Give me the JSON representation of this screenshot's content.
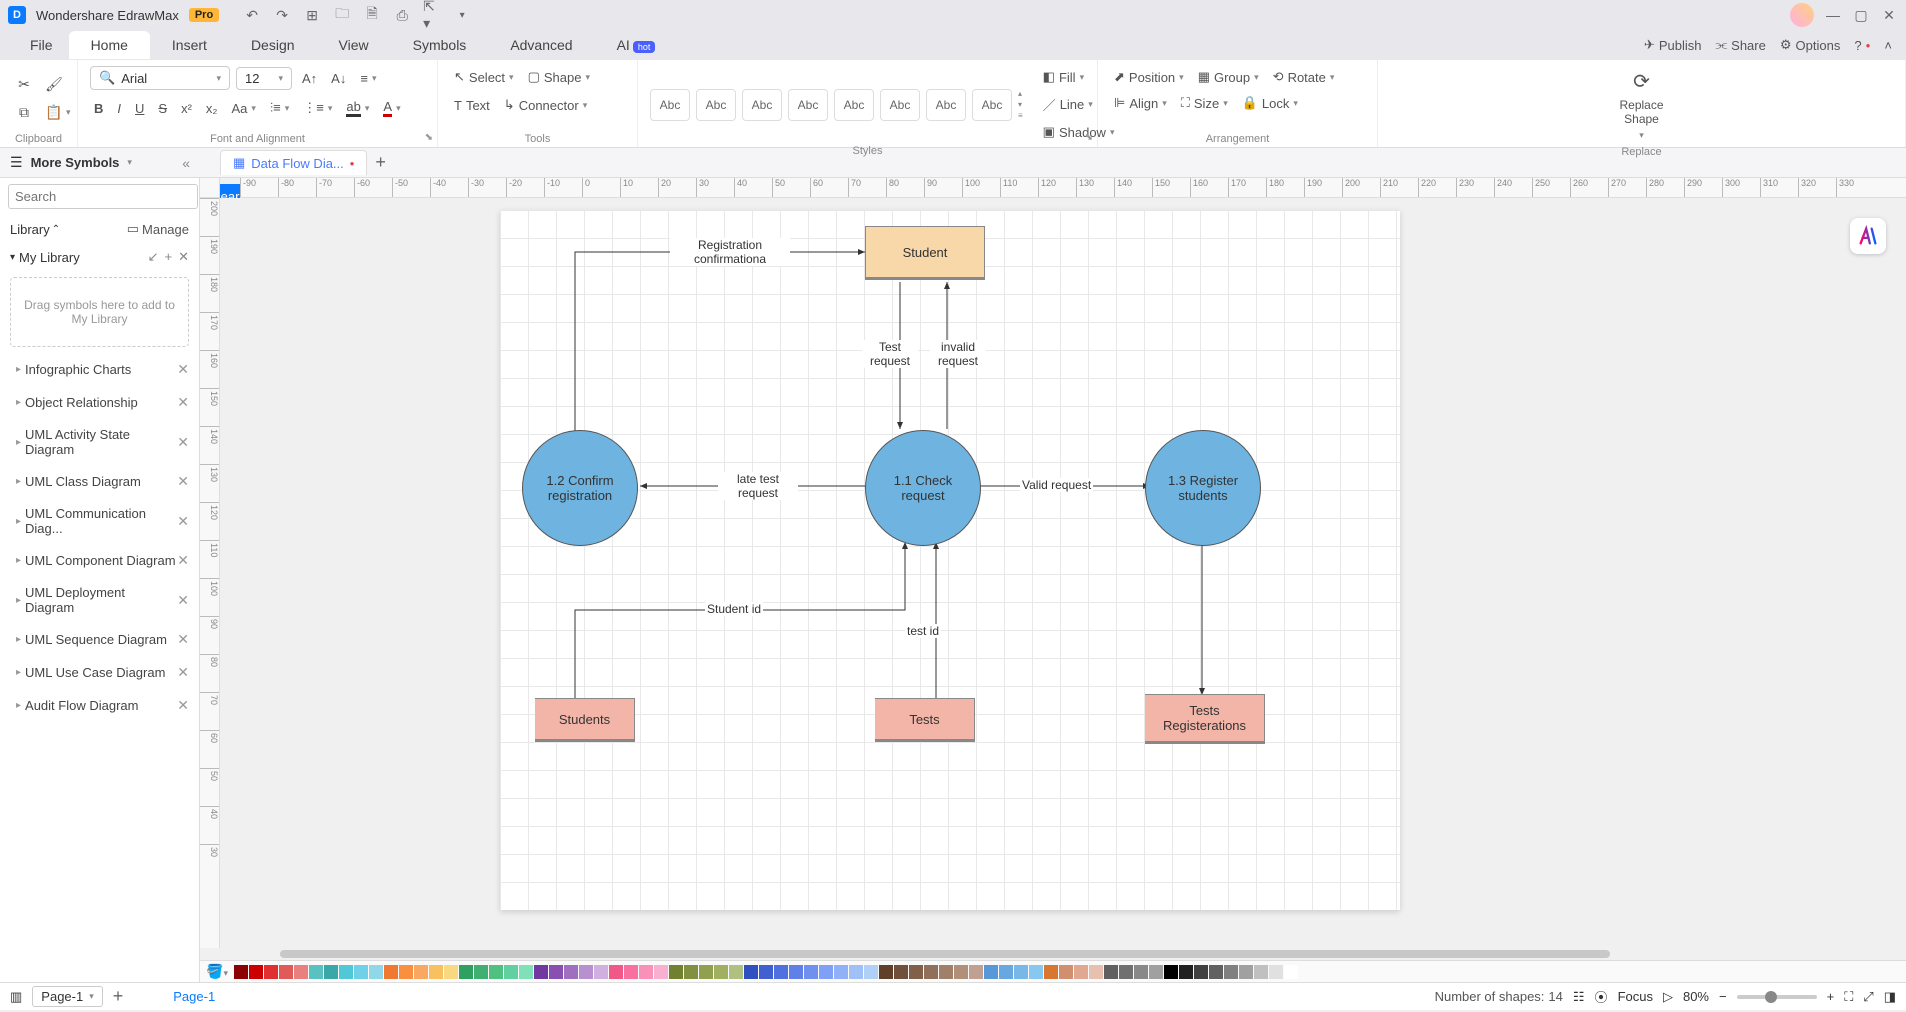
{
  "titlebar": {
    "appname": "Wondershare EdrawMax",
    "pro_badge": "Pro"
  },
  "menu": {
    "file": "File",
    "home": "Home",
    "insert": "Insert",
    "design": "Design",
    "view": "View",
    "symbols": "Symbols",
    "advanced": "Advanced",
    "ai": "AI",
    "hot": "hot",
    "publish": "Publish",
    "share": "Share",
    "options": "Options"
  },
  "ribbon": {
    "clipboard": "Clipboard",
    "font_align": "Font and Alignment",
    "tools": "Tools",
    "styles": "Styles",
    "arrangement": "Arrangement",
    "replace": "Replace",
    "font_name": "Arial",
    "font_size": "12",
    "select": "Select",
    "shape": "Shape",
    "text": "Text",
    "connector": "Connector",
    "abc": "Abc",
    "fill": "Fill",
    "line": "Line",
    "shadow": "Shadow",
    "position": "Position",
    "align": "Align",
    "group": "Group",
    "size": "Size",
    "rotate": "Rotate",
    "lock": "Lock",
    "replace_shape": "Replace\nShape"
  },
  "doc": {
    "tab_name": "Data Flow Dia...",
    "more_symbols": "More Symbols"
  },
  "sidebar": {
    "search_placeholder": "Search",
    "search_btn": "Search",
    "library": "Library",
    "manage": "Manage",
    "mylib": "My Library",
    "dropzone": "Drag symbols here to add to My Library",
    "items": [
      "Infographic Charts",
      "Object Relationship",
      "UML Activity State Diagram",
      "UML Class Diagram",
      "UML Communication Diag...",
      "UML Component Diagram",
      "UML Deployment Diagram",
      "UML Sequence Diagram",
      "UML Use Case Diagram",
      "Audit Flow Diagram"
    ]
  },
  "ruler_h": [
    "-90",
    "-80",
    "-70",
    "-60",
    "-50",
    "-40",
    "-30",
    "-20",
    "-10",
    "0",
    "10",
    "20",
    "30",
    "40",
    "50",
    "60",
    "70",
    "80",
    "90",
    "100",
    "110",
    "120",
    "130",
    "140",
    "150",
    "160",
    "170",
    "180",
    "190",
    "200",
    "210",
    "220",
    "230",
    "240",
    "250",
    "260",
    "270",
    "280",
    "290",
    "300",
    "310",
    "320",
    "330"
  ],
  "ruler_v": [
    "200",
    "190",
    "180",
    "170",
    "160",
    "150",
    "140",
    "130",
    "120",
    "110",
    "100",
    "90",
    "80",
    "70",
    "60",
    "50",
    "40",
    "30"
  ],
  "diagram": {
    "student": "Student",
    "p11": "1.1 Check request",
    "p12": "1.2 Confirm registration",
    "p13": "1.3 Register students",
    "ds_students": "Students",
    "ds_tests": "Tests",
    "ds_testsreg": "Tests Registerations",
    "lbl_regconf": "Registration confirmationa",
    "lbl_testreq": "Test request",
    "lbl_invalid": "invalid request",
    "lbl_latetest": "late test request",
    "lbl_valid": "Valid request",
    "lbl_studentid": "Student id",
    "lbl_testid": "test id"
  },
  "palette": [
    "#8b0000",
    "#c00",
    "#e03030",
    "#e05a5a",
    "#e88080",
    "#5ac0c0",
    "#3aa8a8",
    "#50c8d8",
    "#70d0e8",
    "#90d8e8",
    "#f07830",
    "#f89040",
    "#f8a860",
    "#f8c060",
    "#f8d880",
    "#30a060",
    "#40b070",
    "#50c080",
    "#60d0a0",
    "#80e0b8",
    "#7038a0",
    "#8850b0",
    "#a070c0",
    "#b890d0",
    "#d0b0e0",
    "#f05888",
    "#f870a0",
    "#f890b8",
    "#f8b0d0",
    "#708030",
    "#809040",
    "#90a050",
    "#a0b060",
    "#b0c080",
    "#3050c0",
    "#4060d0",
    "#5070e0",
    "#6080e8",
    "#7090f0",
    "#80a0f8",
    "#90b0f8",
    "#a0c0f8",
    "#b0d0f8",
    "#604028",
    "#705038",
    "#806048",
    "#907058",
    "#a08068",
    "#b09078",
    "#c0a090",
    "#5898d8",
    "#68a8e0",
    "#78b8e8",
    "#88c8f0",
    "#d87830",
    "#d09070",
    "#e0a890",
    "#e8c0b0",
    "#606060",
    "#707070",
    "#888",
    "#a0a0a0",
    "#000",
    "#202020",
    "#404040",
    "#606060",
    "#808080",
    "#a0a0a0",
    "#c0c0c0",
    "#e0e0e0",
    "#fff"
  ],
  "status": {
    "page_sel": "Page-1",
    "page_tab": "Page-1",
    "shapes_label": "Number of shapes:",
    "shapes_count": "14",
    "focus": "Focus",
    "zoom": "80%"
  }
}
